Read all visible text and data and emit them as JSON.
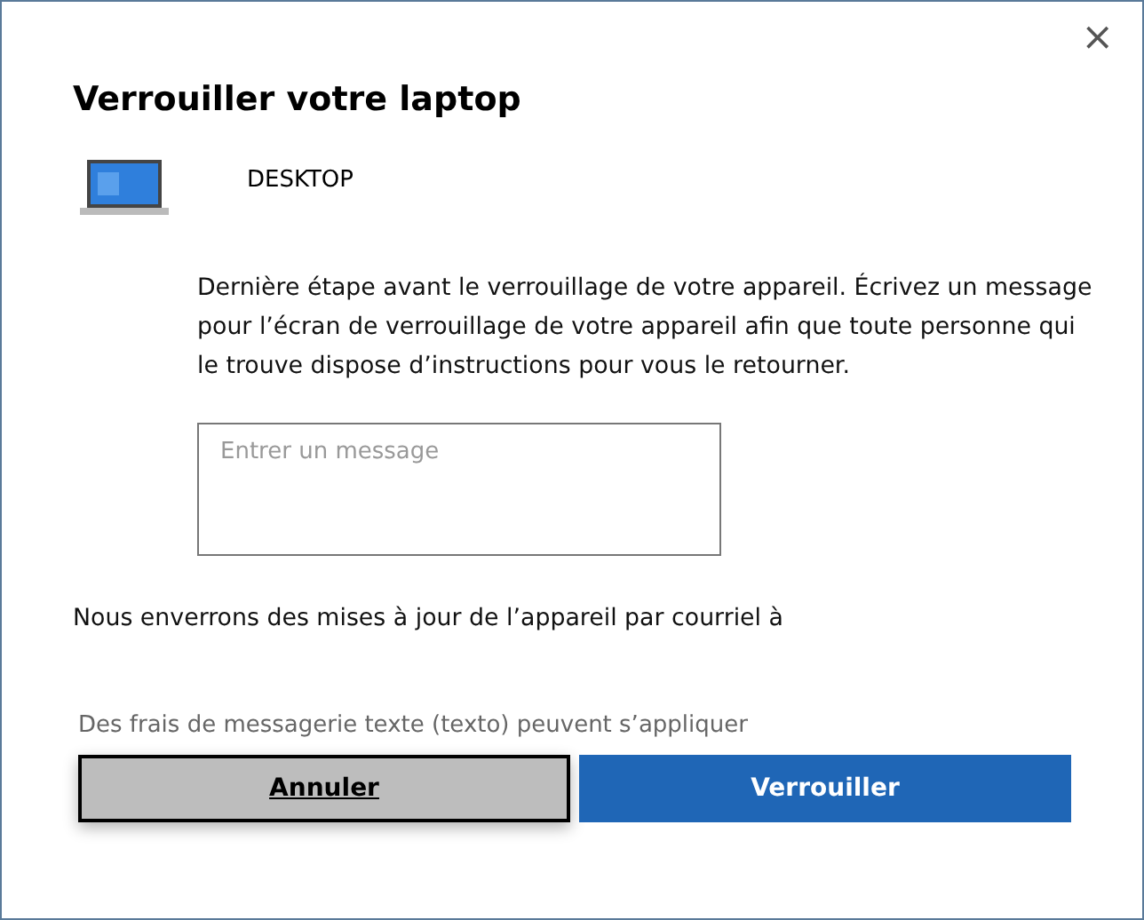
{
  "dialog": {
    "title": "Verrouiller votre laptop",
    "close": "×"
  },
  "device": {
    "name": "DESKTOP"
  },
  "instructions": "Dernière étape avant le verrouillage de votre appareil. Écrivez un message pour l’écran de verrouillage de votre appareil afin que toute personne qui le trouve dispose d’instructions pour vous le retourner.",
  "message_field": {
    "placeholder": "Entrer un message"
  },
  "email_notice": "Nous enverrons des mises à jour de l’appareil par courriel à",
  "fees_notice": "Des frais de messagerie texte (texto) peuvent s’appliquer",
  "buttons": [
    {
      "label": "Annuler",
      "kind": "secondary",
      "focused": true
    },
    {
      "label": "Verrouiller",
      "kind": "primary",
      "focused": false
    }
  ]
}
